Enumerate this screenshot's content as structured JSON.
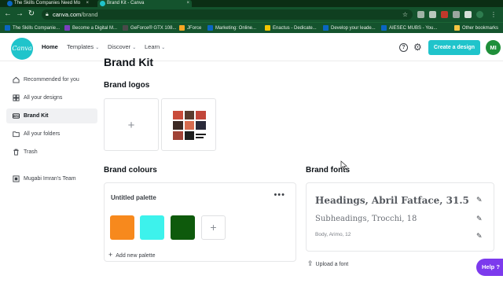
{
  "browser": {
    "tabs": [
      {
        "label": "The Skills Companies Need Mo",
        "active": false
      },
      {
        "label": "Brand Kit - Canva",
        "active": true
      }
    ],
    "url_domain": "canva.com",
    "url_path": "/brand",
    "bookmarks": [
      {
        "label": "The Skills Companie...",
        "color": "#0a66c2"
      },
      {
        "label": "Become a Digital M...",
        "color": "#7a3fbf"
      },
      {
        "label": "GeForce® GTX 108...",
        "color": "#4a4a4a"
      },
      {
        "label": "JForce",
        "color": "#f5a623"
      },
      {
        "label": "Marketing: Online...",
        "color": "#0a66c2"
      },
      {
        "label": "Enactus - Dedicate...",
        "color": "#f2c500"
      },
      {
        "label": "Develop your leade...",
        "color": "#0a66c2"
      },
      {
        "label": "AIESEC MUBS - You...",
        "color": "#0a66c2"
      },
      {
        "label": "Other bookmarks",
        "color": "#f5c542"
      }
    ]
  },
  "header": {
    "logo_text": "Canva",
    "nav": [
      {
        "label": "Home",
        "active": true,
        "dropdown": false
      },
      {
        "label": "Templates",
        "active": false,
        "dropdown": true
      },
      {
        "label": "Discover",
        "active": false,
        "dropdown": true
      },
      {
        "label": "Learn",
        "active": false,
        "dropdown": true
      }
    ],
    "help_icon": "?",
    "settings_icon": "⚙",
    "create_label": "Create a design",
    "avatar_initials": "MI",
    "accent": "#20c4cb"
  },
  "sidebar": {
    "items": [
      {
        "label": "Recommended for you",
        "icon": "home-icon",
        "active": false
      },
      {
        "label": "All your designs",
        "icon": "grid-icon",
        "active": false
      },
      {
        "label": "Brand Kit",
        "icon": "brand-icon",
        "active": true
      },
      {
        "label": "All your folders",
        "icon": "folder-icon",
        "active": false
      },
      {
        "label": "Trash",
        "icon": "trash-icon",
        "active": false
      },
      {
        "label": "Mugabi Imran's Team",
        "icon": "team-icon",
        "active": false
      }
    ]
  },
  "main": {
    "title": "Brand Kit",
    "logos_title": "Brand logos",
    "add_logo_symbol": "+",
    "colours_title": "Brand colours",
    "palette": {
      "name": "Untitled palette",
      "menu": "•••",
      "colors": [
        "#f7891d",
        "#3df2ec",
        "#0e5a0c"
      ],
      "add_symbol": "+"
    },
    "add_palette_label": "Add new palette",
    "fonts_title": "Brand fonts",
    "fonts": [
      {
        "label": "Headings, Abril Fatface, 31.5"
      },
      {
        "label": "Subheadings, Trocchi, 18"
      },
      {
        "label": "Body, Arimo, 12"
      }
    ],
    "upload_label": "Upload a font"
  },
  "help_button": "Help ?"
}
